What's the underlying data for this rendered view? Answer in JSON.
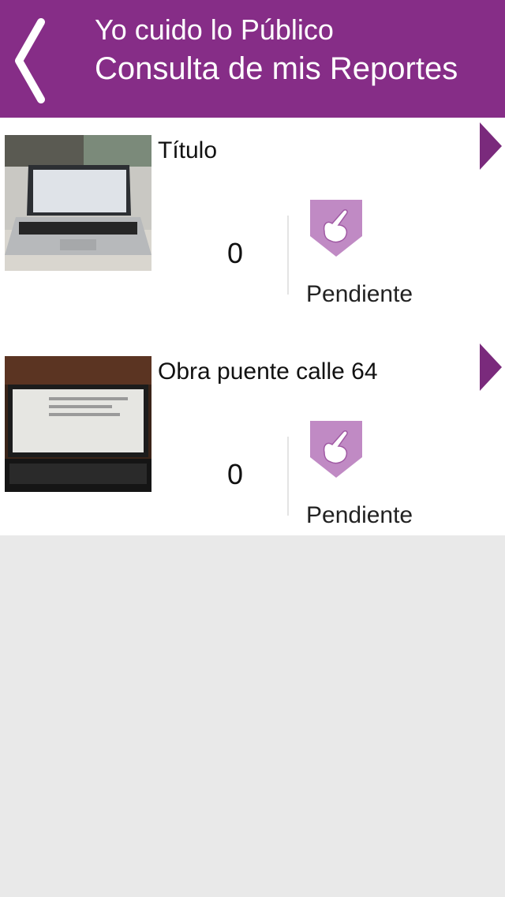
{
  "header": {
    "title_line1": "Yo cuido lo Público",
    "title_line2": "Consulta de mis Reportes",
    "color": "#862d87"
  },
  "reports": [
    {
      "title": "Título",
      "count": "0",
      "status": "Pendiente",
      "thumbnail_icon": "laptop-photo",
      "status_icon": "hand-pointer-icon"
    },
    {
      "title": "Obra puente calle 64",
      "count": "0",
      "status": "Pendiente",
      "thumbnail_icon": "laptop-photo",
      "status_icon": "hand-pointer-icon"
    }
  ],
  "colors": {
    "accent": "#862d87",
    "status_badge": "#c08ac4",
    "background": "#e9e9e9"
  }
}
